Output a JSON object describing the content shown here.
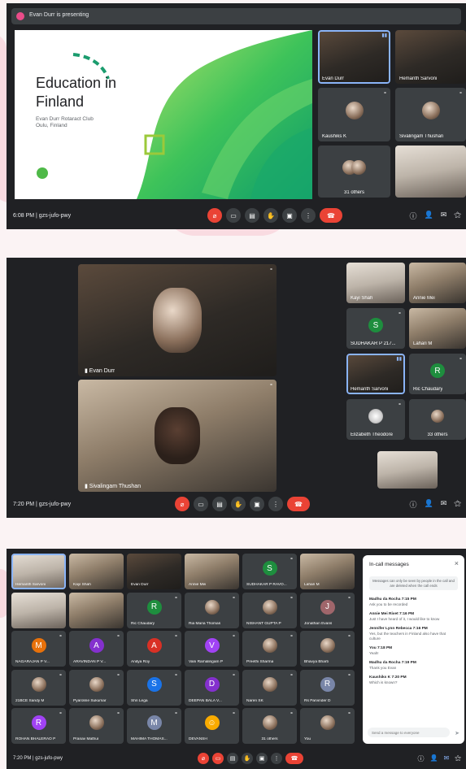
{
  "screen1": {
    "presenting_text": "Evan Durr is presenting",
    "slide": {
      "title_line1": "Education in",
      "title_line2": "Finland",
      "subtitle_line1": "Evan Durr Rotaract Club",
      "subtitle_line2": "Oulu, Finland"
    },
    "tiles": [
      {
        "name": "Evan Durr"
      },
      {
        "name": "Hemanth Sarvoni"
      },
      {
        "name": "Kaushiks K"
      },
      {
        "name": "Sivalingam Thushan"
      },
      {
        "name": "31 others"
      },
      {
        "name": ""
      }
    ],
    "time": "6:08 PM",
    "code": "gzs-jufo-pwy"
  },
  "screen2": {
    "main_tiles": [
      {
        "name": "Evan Durr"
      },
      {
        "name": "Sivalingam Thushan"
      }
    ],
    "side_tiles": [
      {
        "name": "Kayi Shah",
        "initial": ""
      },
      {
        "name": "Annie Mei",
        "initial": ""
      },
      {
        "name": "SUDHAKAR P 217...",
        "initial": "S"
      },
      {
        "name": "Lahari M",
        "initial": ""
      },
      {
        "name": "Hemanth Sarvoni",
        "initial": ""
      },
      {
        "name": "Ric Chaudary",
        "initial": "R"
      },
      {
        "name": "Elizabeth Theodore",
        "initial": ""
      },
      {
        "name": "33 others",
        "initial": ""
      }
    ],
    "time": "7:20 PM",
    "code": "gzs-jufo-pwy"
  },
  "screen3": {
    "tiles": [
      {
        "name": "Hemanth Sarvoni",
        "initial": "",
        "color": ""
      },
      {
        "name": "Kayi Shah",
        "initial": "",
        "color": ""
      },
      {
        "name": "Evan Durr",
        "initial": "",
        "color": ""
      },
      {
        "name": "Annie Mei",
        "initial": "",
        "color": ""
      },
      {
        "name": "SUDHAKAR P RAVO...",
        "initial": "S",
        "color": "#1e8e3e"
      },
      {
        "name": "Lahari M",
        "initial": "",
        "color": ""
      },
      {
        "name": "",
        "initial": "",
        "color": ""
      },
      {
        "name": "",
        "initial": "",
        "color": ""
      },
      {
        "name": "Ric Chaudary",
        "initial": "R",
        "color": "#1e8e3e"
      },
      {
        "name": "Ria Maria Thomas",
        "initial": "",
        "color": ""
      },
      {
        "name": "NISHANT GUPTA P",
        "initial": "",
        "color": ""
      },
      {
        "name": "Jonathan Evans",
        "initial": "J",
        "color": "#a0666b"
      },
      {
        "name": "NAGARAJAN P V...",
        "initial": "M",
        "color": "#e8710a"
      },
      {
        "name": "ARAVINDAN P V...",
        "initial": "A",
        "color": "#8430ce"
      },
      {
        "name": "Anitya Roy",
        "initial": "A",
        "color": "#d93025"
      },
      {
        "name": "Vani Ramalingam P",
        "initial": "V",
        "color": "#a142f4"
      },
      {
        "name": "Preethi Sharma",
        "initial": "",
        "color": ""
      },
      {
        "name": "Bhavya Bharti",
        "initial": "",
        "color": ""
      },
      {
        "name": "21BCE Sandy M",
        "initial": "",
        "color": ""
      },
      {
        "name": "Pyaroline Sukumar",
        "initial": "",
        "color": ""
      },
      {
        "name": "Shri Lega",
        "initial": "S",
        "color": "#1a73e8"
      },
      {
        "name": "DEEPAN BALA V...",
        "initial": "D",
        "color": "#8430ce"
      },
      {
        "name": "Naren SK",
        "initial": "",
        "color": ""
      },
      {
        "name": "Rs Parvinder D",
        "initial": "R",
        "color": "#7986a8"
      },
      {
        "name": "ROHAN BHALERAO P",
        "initial": "R",
        "color": "#a142f4"
      },
      {
        "name": "Pranav Mathur",
        "initial": "",
        "color": ""
      },
      {
        "name": "MAHIMA THOMAS...",
        "initial": "M",
        "color": "#7986a8"
      },
      {
        "name": "DEVANSH",
        "initial": "",
        "color": "#f9ab00"
      },
      {
        "name": "31 others",
        "initial": "",
        "color": ""
      },
      {
        "name": "You",
        "initial": "",
        "color": ""
      }
    ],
    "chat": {
      "title": "In-call messages",
      "notice": "Messages can only be seen by people in the call and are deleted when the call ends",
      "messages": [
        {
          "sender": "Madhu da Rocha  7:15 PM",
          "text": "Ask you to be recorded"
        },
        {
          "sender": "Annie Mei Rivet  7:16 PM",
          "text": "Just I have heard of it, I would like to know"
        },
        {
          "sender": "Jennifer Lynn Rebecca  7:16 PM",
          "text": "Yes, but the teachers in Finland also have that culture"
        },
        {
          "sender": "You  7:18 PM",
          "text": "Yeah!"
        },
        {
          "sender": "Madhu da Rocha  7:19 PM",
          "text": "Thank you Evan"
        },
        {
          "sender": "Kaushiks K  7:20 PM",
          "text": "Which is known?"
        }
      ],
      "input_placeholder": "Send a message to everyone"
    },
    "time": "7:20 PM",
    "code": "gzs-jufo-pwy"
  }
}
